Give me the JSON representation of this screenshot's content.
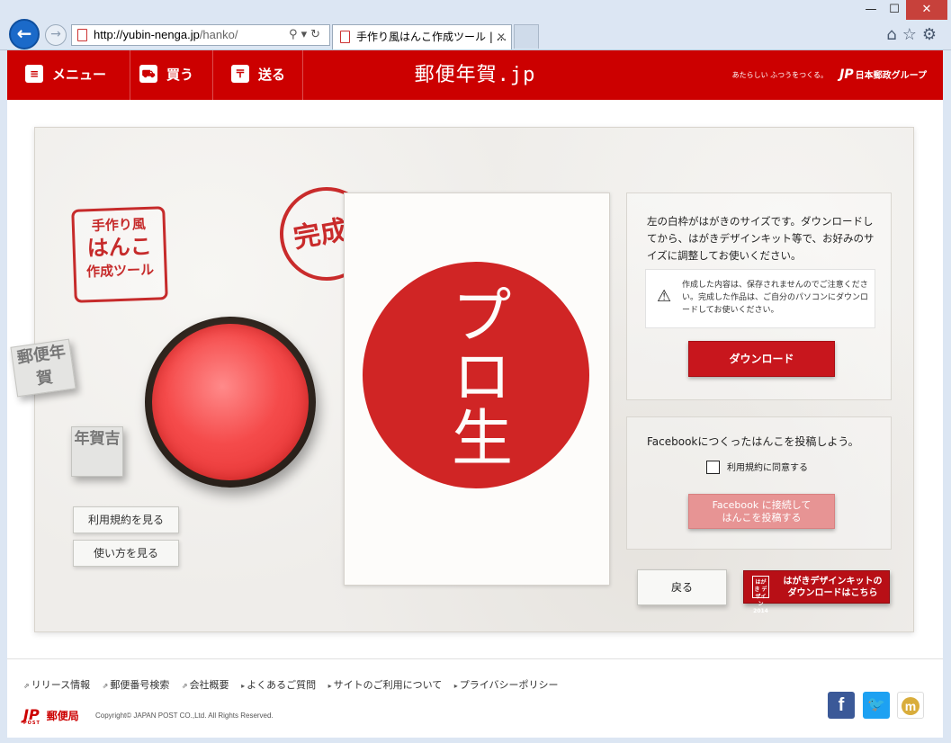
{
  "browser": {
    "url_host": "http://yubin-nenga.jp",
    "url_path": "/hanko/",
    "tab_title": "手作り風はんこ作成ツール | ...",
    "tab_close": "✕",
    "win_min": "—",
    "win_max": "☐",
    "win_close": "✕",
    "back_glyph": "←",
    "fwd_glyph": "→",
    "addr_icons": "⚲▾↻",
    "tool_icons": "⌂☆⚙"
  },
  "header": {
    "menu_label": "メニュー",
    "buy_label": "買う",
    "send_label": "送る",
    "site_title": "郵便年賀.jp",
    "tagline": "あたらしい ふつうをつくる。",
    "group_mark": "JP",
    "group_name": "日本郵政グループ"
  },
  "left": {
    "logo_line1": "手作り風",
    "logo_line2": "はんこ",
    "logo_line3": "作成ツール",
    "stamp1_text": "郵便年賀",
    "stamp2_text": "年賀吉",
    "terms_button": "利用規約を見る",
    "howto_button": "使い方を見る"
  },
  "center": {
    "completed_stamp": "完成!",
    "seal_text": "プロ生"
  },
  "download_panel": {
    "description": "左の白枠がはがきのサイズです。ダウンロードしてから、はがきデザインキット等で、お好みのサイズに調整してお使いください。",
    "warning_icon": "⚠",
    "notice": "作成した内容は、保存されませんのでご注意ください。完成した作品は、ご自分のパソコンにダウンロードしてお使いください。",
    "download_button": "ダウンロード"
  },
  "facebook_panel": {
    "prompt": "Facebookにつくったはんこを投稿しよう。",
    "agree_label": "利用規約に同意する",
    "agree_checked": false,
    "connect_line1": "Facebook に接続して",
    "connect_line2": "はんこを投稿する"
  },
  "actions": {
    "back_button": "戻る",
    "kit_icon": "はがき デザイン 2014",
    "kit_line1": "はがきデザインキットの",
    "kit_line2": "ダウンロードはこちら"
  },
  "footer": {
    "links": [
      "リリース情報",
      "郵便番号検索",
      "会社概要",
      "よくあるご質問",
      "サイトのご利用について",
      "プライバシーポリシー"
    ],
    "logo_mark": "JP",
    "logo_sub": "POST",
    "logo_name": "郵便局",
    "copyright": "Copyright© JAPAN POST CO.,Ltd. All Rights Reserved.",
    "facebook_glyph": "f",
    "twitter_glyph": "🐦",
    "mixi_glyph": "m"
  },
  "colors": {
    "brand_red": "#cc0000",
    "seal_red": "#d02525",
    "facebook_blue": "#3b5998",
    "twitter_blue": "#1da1f2"
  }
}
